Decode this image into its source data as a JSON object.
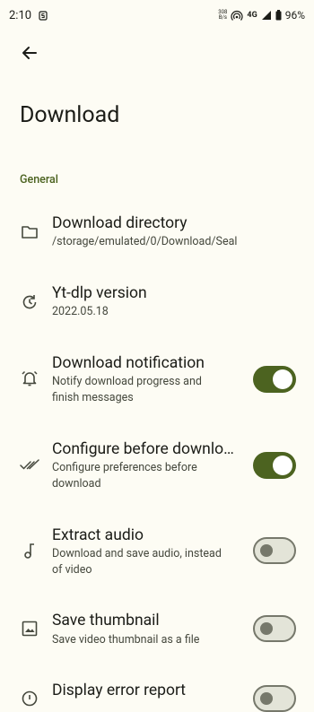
{
  "status_bar": {
    "time": "2:10",
    "net_speed_value": "308",
    "net_speed_unit": "B/s",
    "network_type": "4G",
    "battery": "96%"
  },
  "header": {
    "title": "Download"
  },
  "section": {
    "general_label": "General"
  },
  "settings": [
    {
      "title": "Download directory",
      "description": "/storage/emulated/0/Download/Seal",
      "icon": "folder-icon"
    },
    {
      "title": "Yt-dlp version",
      "description": "2022.05.18",
      "icon": "update-icon"
    },
    {
      "title": "Download notification",
      "description": "Notify download progress and finish messages",
      "icon": "alarm-bell-icon",
      "toggle": true
    },
    {
      "title": "Configure before download",
      "description": "Configure preferences before download",
      "icon": "double-check-icon",
      "toggle": true
    },
    {
      "title": "Extract audio",
      "description": "Download and save audio, instead of video",
      "icon": "music-note-icon",
      "toggle": false
    },
    {
      "title": "Save thumbnail",
      "description": "Save video thumbnail as a file",
      "icon": "image-icon",
      "toggle": false
    },
    {
      "title": "Display error report",
      "description": "",
      "icon": "error-icon",
      "toggle": false
    }
  ],
  "colors": {
    "accent": "#4c6320",
    "background": "#fdfcf4",
    "toggle_off_track": "#e3e4d8",
    "toggle_off_outline": "#76786b"
  }
}
